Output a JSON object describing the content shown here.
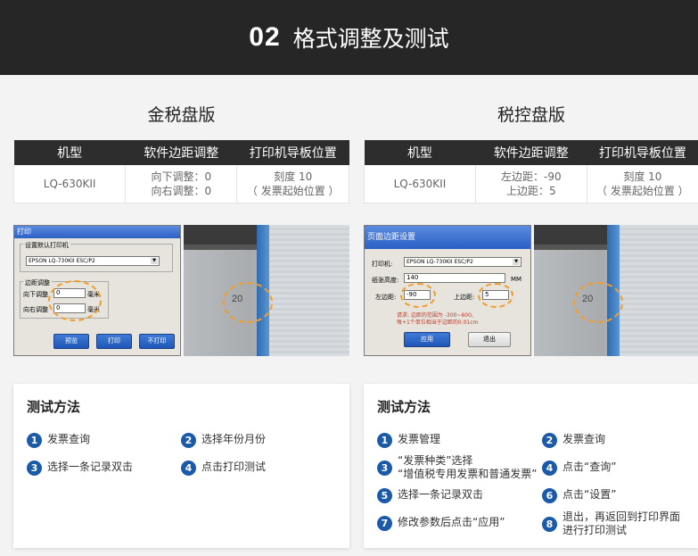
{
  "banner": {
    "number": "02",
    "title": "格式调整及测试"
  },
  "table_headers": [
    "机型",
    "软件边距调整",
    "打印机导板位置"
  ],
  "left": {
    "title": "金税盘版",
    "row": {
      "model": "LQ-630KII",
      "adjust": [
        "向下调整：0",
        "向右调整：0"
      ],
      "guide": [
        "刻度 10",
        "（ 发票起始位置 ）"
      ]
    },
    "dialog": {
      "title": "打印",
      "group1": "设置默认打印机",
      "printer": "EPSON LQ-730KII ESC/P2",
      "group2": "边距调整",
      "down_label": "向下调整",
      "down_value": "0",
      "right_label": "向右调整",
      "right_value": "0",
      "unit": "毫米",
      "buttons": [
        "预览",
        "打印",
        "不打印"
      ]
    },
    "photo_scale": "20",
    "steps_title": "测试方法",
    "steps": [
      {
        "n": "1",
        "lines": [
          "发票查询"
        ]
      },
      {
        "n": "2",
        "lines": [
          "选择年份月份"
        ]
      },
      {
        "n": "3",
        "lines": [
          "选择一条记录双击"
        ]
      },
      {
        "n": "4",
        "lines": [
          "点击打印测试"
        ]
      }
    ]
  },
  "right": {
    "title": "税控盘版",
    "row": {
      "model": "LQ-630KII",
      "adjust": [
        "左边距：-90",
        "上边距：5"
      ],
      "guide": [
        "刻度 10",
        "（ 发票起始位置 ）"
      ]
    },
    "dialog": {
      "title": "页面边距设置",
      "printer_label": "打印机:",
      "printer": "EPSON LQ-730KII ESC/P2",
      "height_label": "纸张高度:",
      "height_value": "140",
      "unit": "MM",
      "left_label": "左边距:",
      "left_value": "-90",
      "top_label": "上边距:",
      "top_value": "5",
      "note": [
        "请求: 边距的范围为 -300~600,",
        "每+1个单位相当于边距的0.01cm"
      ],
      "buttons": [
        "应用",
        "退出"
      ]
    },
    "photo_scale": "20",
    "steps_title": "测试方法",
    "steps": [
      {
        "n": "1",
        "lines": [
          "发票管理"
        ]
      },
      {
        "n": "2",
        "lines": [
          "发票查询"
        ]
      },
      {
        "n": "3",
        "lines": [
          "“发票种类”选择",
          "“增值税专用发票和普通发票”"
        ]
      },
      {
        "n": "4",
        "lines": [
          "点击“查询”"
        ]
      },
      {
        "n": "5",
        "lines": [
          "选择一条记录双击"
        ]
      },
      {
        "n": "6",
        "lines": [
          "点击“设置”"
        ]
      },
      {
        "n": "7",
        "lines": [
          "修改参数后点击“应用”"
        ]
      },
      {
        "n": "8",
        "lines": [
          "退出，再返回到打印界面",
          "进行打印测试"
        ]
      }
    ]
  }
}
